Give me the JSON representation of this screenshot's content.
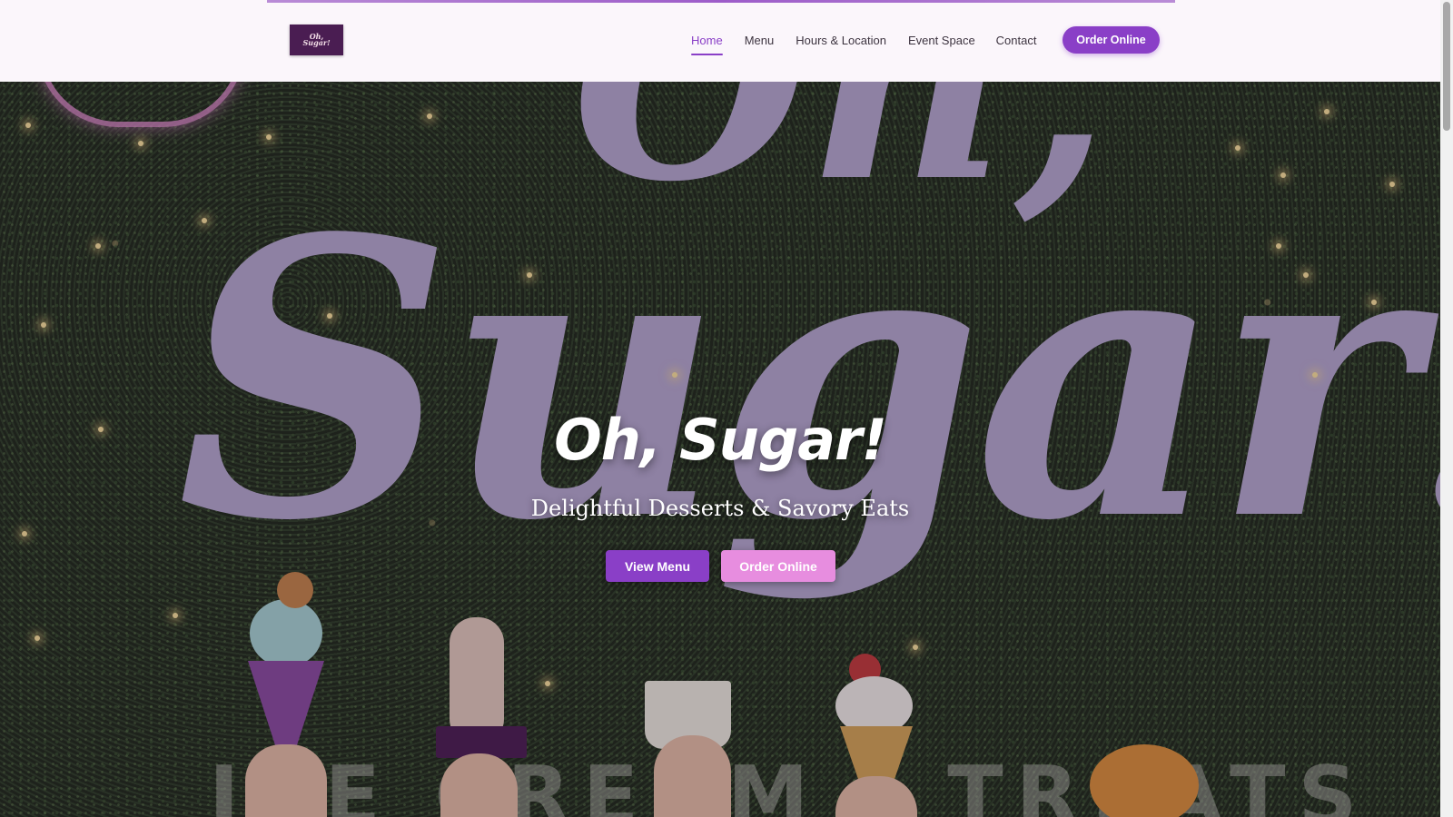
{
  "header": {
    "logo_text": "Oh, Sugar!",
    "nav": [
      "Home",
      "Menu",
      "Hours & Location",
      "Event Space",
      "Contact"
    ],
    "active_nav": "Home",
    "order_button": "Order Online"
  },
  "hero": {
    "title": "Oh, Sugar!",
    "subtitle": "Delightful Desserts & Savory Eats",
    "primary_button": "View Menu",
    "secondary_button": "Order Online",
    "background_sign_top": "Oh,",
    "background_sign_main": "Sugar!",
    "background_sign_bottom": "ICE CREAM · TREATS"
  },
  "colors": {
    "accent": "#8a3fc7",
    "pink": "#e78ddf",
    "logo_bg": "#4a1d52",
    "header_bg": "#fbf6fb"
  }
}
